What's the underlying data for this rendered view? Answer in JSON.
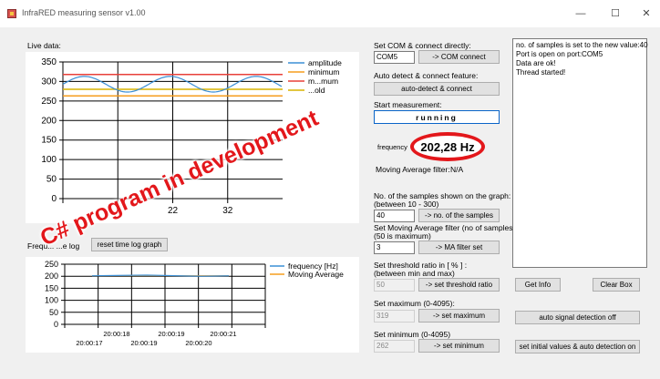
{
  "window": {
    "title": "InfraRED measuring sensor v1.00",
    "minimize": "—",
    "maximize": "☐",
    "close": "✕"
  },
  "live": {
    "label": "Live data:",
    "y_ticks": [
      "350",
      "300",
      "250",
      "200",
      "150",
      "100",
      "50",
      "0"
    ],
    "x_ticks": [
      "22",
      "32"
    ],
    "legend": [
      "amplitude",
      "minimum",
      "maximum",
      "threshold"
    ],
    "legend_shown": [
      "amplitude",
      "minimum",
      "m...mum",
      "...old"
    ],
    "legend_colors": [
      "#3b8fd6",
      "#f59d1e",
      "#e8403a",
      "#d9b400"
    ],
    "series": {
      "minimum": 263,
      "threshold": 280,
      "maximum": 318,
      "amplitude_mean": 293,
      "amplitude_swing": 20
    }
  },
  "log": {
    "label": "Frequ...    ...e log",
    "reset_button": "reset time log graph",
    "y_ticks": [
      "250",
      "200",
      "150",
      "100",
      "50",
      "0"
    ],
    "x_ticks_top": [
      "20:00:18",
      "20:00:19",
      "20:00:21"
    ],
    "x_ticks_bottom": [
      "20:00:17",
      "20:00:19",
      "20:00:20"
    ],
    "legend": [
      "frequency [Hz]",
      "Moving Average"
    ],
    "legend_colors": [
      "#3b8fd6",
      "#f59d1e"
    ],
    "frequency_value": 202
  },
  "com": {
    "label": "Set COM & connect directly:",
    "port_value": "COM5",
    "connect_button": "->  COM  connect",
    "auto_label": "Auto detect & connect feature:",
    "auto_button": "auto-detect & connect"
  },
  "measurement": {
    "label": "Start measurement:",
    "state": "running"
  },
  "frequency": {
    "label": "frequency",
    "value": "202,28 Hz",
    "ma_label": "Moving Average filter:",
    "ma_value": "N/A"
  },
  "samples": {
    "label": "No. of the samples shown on the graph:",
    "range": "(between 10 - 300)",
    "value": "40",
    "button": "->  no. of the samples",
    "ma_label": "Set Moving Average filter (no of samples)>",
    "ma_range": "(50 is maximum)",
    "ma_value": "3",
    "ma_button": "->  MA  filter set"
  },
  "threshold": {
    "label": "Set threshold ratio in [ % ] :",
    "range": "(between min and max)",
    "value": "50",
    "button": "->  set  threshold ratio"
  },
  "maximum": {
    "label": "Set maximum (0-4095):",
    "value": "319",
    "button": "->  set maximum"
  },
  "minimum": {
    "label": "Set minimum (0-4095)",
    "value": "262",
    "button": "->  set minimum"
  },
  "status_log": [
    "no. of samples is set to the new value:40",
    "Port is open on port:COM5",
    "Data are ok!",
    "Thread started!"
  ],
  "actions": {
    "get_info": "Get Info",
    "clear_box": "Clear Box",
    "auto_signal_off": "auto signal detection off",
    "set_initial": "set initial values & auto detection on"
  },
  "overlay_text": "C# program in development"
}
